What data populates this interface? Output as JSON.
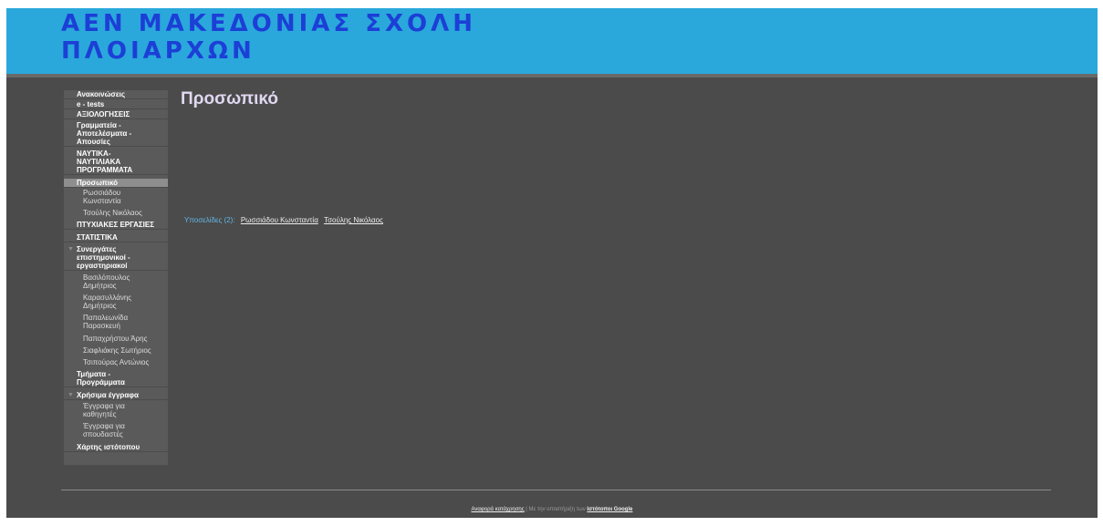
{
  "site": {
    "title": "ΑΕΝ ΜΑΚΕΔΟΝΙΑΣ ΣΧΟΛΗ ΠΛΟΙΑΡΧΩΝ"
  },
  "sidebar": {
    "items": [
      {
        "label": "Ανακοινώσεις"
      },
      {
        "label": "e - tests"
      },
      {
        "label": "ΑΞΙΟΛΟΓΗΣΕΙΣ"
      },
      {
        "label": "Γραμματεία - Αποτελέσματα - Απουσίες"
      },
      {
        "label": "ΝΑΥΤΙΚΑ-ΝΑΥΤΙΛΙΑΚΑ ΠΡΟΓΡΑΜΜΑΤΑ"
      },
      {
        "label": "Προσωπικό",
        "children": [
          "Ρωσσιάδου Κωνσταντία",
          "Τσούλης Νικόλαος"
        ]
      },
      {
        "label": "ΠΤΥΧΙΑΚΕΣ ΕΡΓΑΣΙΕΣ"
      },
      {
        "label": "ΣΤΑΤΙΣΤΙΚΑ"
      },
      {
        "label": "Συνεργάτες επιστημονικοί - εργαστηριακοί",
        "children": [
          "Βασιλόπουλος Δημήτριος",
          "Καρασυλλάνης Δημήτριος",
          "Παπαλεωνίδα Παρασκευή",
          "Παπαχρήστου Άρης",
          "Σιαφλιάκης Σωτήριος",
          "Τσιπούρας Αντώνιος"
        ]
      },
      {
        "label": "Τμήματα - Προγράμματα"
      },
      {
        "label": "Χρήσιμα έγγραφα",
        "children": [
          "Έγγραφα για καθηγητές",
          "Έγγραφα για σπουδαστές"
        ]
      },
      {
        "label": "Χάρτης ιστότοπου"
      }
    ]
  },
  "main": {
    "title": "Προσωπικό",
    "subpages_label": "Υποσελίδες (2):",
    "subpages": [
      "Ρωσσιάδου Κωνσταντία",
      "Τσούλης Νικόλαος"
    ]
  },
  "footer": {
    "report": "Αναφορά κατάχρησης",
    "sep": " | Με την υποστήριξη των ",
    "sites": "Ιστότοποι Google"
  }
}
